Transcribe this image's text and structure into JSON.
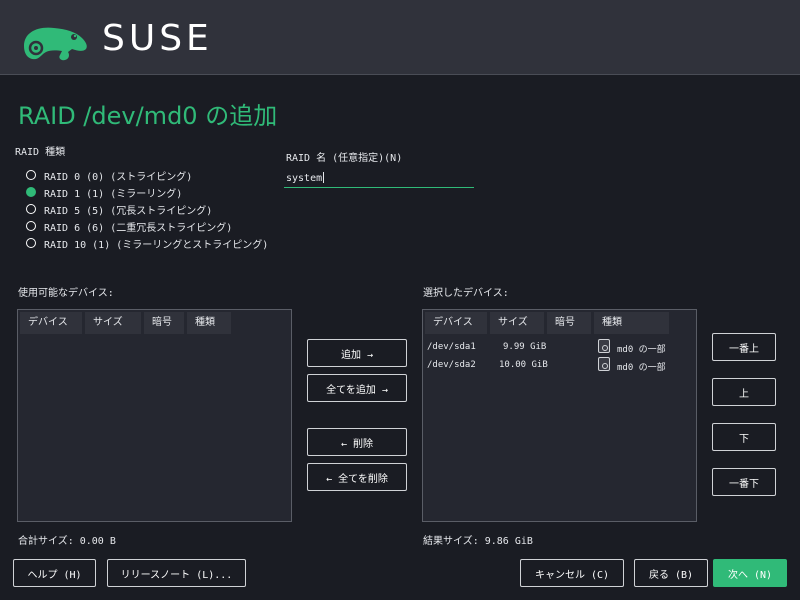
{
  "brand": {
    "name": "SUSE",
    "color": "#30ba78"
  },
  "page_title": "RAID /dev/md0 の追加",
  "raid_type": {
    "label": "RAID 種類",
    "options": [
      {
        "label": "RAID 0 (0) (ストライピング)",
        "checked": false
      },
      {
        "label": "RAID 1 (1) (ミラーリング)",
        "checked": true
      },
      {
        "label": "RAID 5 (5) (冗長ストライピング)",
        "checked": false
      },
      {
        "label": "RAID 6 (6) (二重冗長ストライピング)",
        "checked": false
      },
      {
        "label": "RAID 10 (1) (ミラーリングとストライピング)",
        "checked": false
      }
    ]
  },
  "raid_name": {
    "label": "RAID 名 (任意指定)(N)",
    "value": "system"
  },
  "available": {
    "label": "使用可能なデバイス:",
    "headers": [
      "デバイス",
      "サイズ",
      "暗号",
      "種類"
    ],
    "rows": [],
    "total": "合計サイズ: 0.00 B"
  },
  "selected": {
    "label": "選択したデバイス:",
    "headers": [
      "デバイス",
      "サイズ",
      "暗号",
      "種類"
    ],
    "rows": [
      {
        "device": "/dev/sda1",
        "size": "9.99 GiB",
        "encryption": "",
        "type": "md0 の一部",
        "icon": "disk-icon"
      },
      {
        "device": "/dev/sda2",
        "size": "10.00 GiB",
        "encryption": "",
        "type": "md0 の一部",
        "icon": "disk-icon"
      }
    ],
    "total": "結果サイズ: 9.86 GiB"
  },
  "transfer_buttons": {
    "add": "追加 →",
    "add_all": "全てを追加 →",
    "remove": "← 削除",
    "remove_all": "← 全てを削除"
  },
  "order_buttons": {
    "top": "一番上",
    "up": "上",
    "down": "下",
    "bottom": "一番下"
  },
  "footer": {
    "help": "ヘルプ (H)",
    "release_notes": "リリースノート (L)...",
    "cancel": "キャンセル (C)",
    "back": "戻る (B)",
    "next": "次へ (N)"
  }
}
